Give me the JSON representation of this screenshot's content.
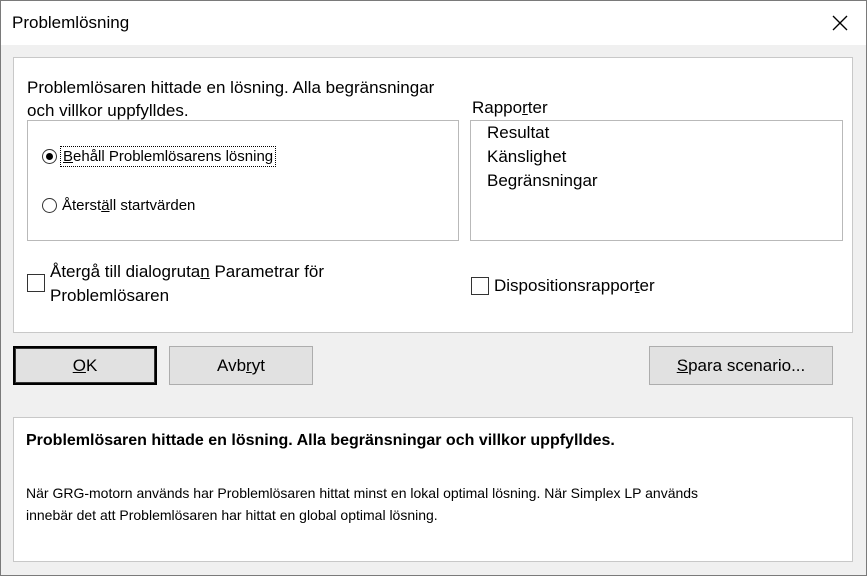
{
  "window": {
    "title": "Problemlösning"
  },
  "panel": {
    "message_line1": "Problemlösaren hittade en lösning. Alla begränsningar",
    "message_line2": "och villkor uppfylldes.",
    "options": [
      {
        "label_pre": "",
        "label_u": "B",
        "label_post": "ehåll Problemlösarens lösning",
        "selected": true
      },
      {
        "label_pre": "Återst",
        "label_u": "ä",
        "label_post": "ll startvärden",
        "selected": false
      }
    ],
    "reports_label_pre": "Rappo",
    "reports_label_u": "r",
    "reports_label_post": "ter",
    "reports": [
      "Resultat",
      "Känslighet",
      "Begränsningar"
    ],
    "return_checkbox": {
      "line1_pre": "Återgå till dialogruta",
      "line1_u": "n",
      "line1_post": " Parametrar för",
      "line2": "Problemlösaren",
      "checked": false
    },
    "outline_checkbox": {
      "label_pre": "Dispositionsrappor",
      "label_u": "t",
      "label_post": "er",
      "checked": false
    }
  },
  "buttons": {
    "ok": {
      "u": "O",
      "post": "K"
    },
    "cancel": {
      "pre": "Avb",
      "u": "r",
      "post": "yt"
    },
    "save": {
      "u": "S",
      "post": "para scenario..."
    }
  },
  "info": {
    "bold": "Problemlösaren hittade en lösning. Alla begränsningar och villkor uppfylldes.",
    "detail_line1": "När GRG-motorn används har Problemlösaren hittat minst en lokal optimal lösning. När Simplex LP används",
    "detail_line2": "innebär det att Problemlösaren har hittat en global optimal lösning."
  }
}
